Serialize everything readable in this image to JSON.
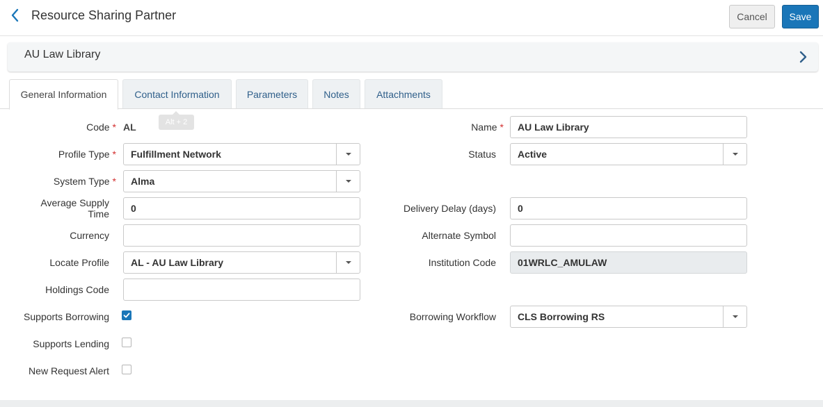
{
  "header": {
    "title": "Resource Sharing Partner",
    "cancel_label": "Cancel",
    "save_label": "Save"
  },
  "record": {
    "name": "AU Law Library"
  },
  "tabs": [
    {
      "label": "General Information",
      "active": true
    },
    {
      "label": "Contact Information",
      "active": false
    },
    {
      "label": "Parameters",
      "active": false
    },
    {
      "label": "Notes",
      "active": false
    },
    {
      "label": "Attachments",
      "active": false
    }
  ],
  "tooltip": "Alt + 2",
  "form": {
    "code": {
      "label": "Code",
      "value": "AL"
    },
    "name": {
      "label": "Name",
      "value": "AU Law Library"
    },
    "profile_type": {
      "label": "Profile Type",
      "value": "Fulfillment Network"
    },
    "status": {
      "label": "Status",
      "value": "Active"
    },
    "system_type": {
      "label": "System Type",
      "value": "Alma"
    },
    "average_supply_time": {
      "label_line1": "Average Supply",
      "label_line2": "Time",
      "value": "0"
    },
    "delivery_delay": {
      "label": "Delivery Delay (days)",
      "value": "0"
    },
    "currency": {
      "label": "Currency",
      "value": ""
    },
    "alternate_symbol": {
      "label": "Alternate Symbol",
      "value": ""
    },
    "locate_profile": {
      "label": "Locate Profile",
      "value": "AL - AU Law Library"
    },
    "institution_code": {
      "label": "Institution Code",
      "value": "01WRLC_AMULAW"
    },
    "holdings_code": {
      "label": "Holdings Code",
      "value": ""
    },
    "supports_borrowing": {
      "label": "Supports Borrowing",
      "checked": true
    },
    "borrowing_workflow": {
      "label": "Borrowing Workflow",
      "value": "CLS Borrowing RS"
    },
    "supports_lending": {
      "label": "Supports Lending",
      "checked": false
    },
    "new_request_alert": {
      "label": "New Request Alert",
      "checked": false
    }
  },
  "required_mark": "*",
  "colors": {
    "accent": "#1a76b8",
    "required": "#d32f2f",
    "tab_text": "#2f5f8a"
  }
}
